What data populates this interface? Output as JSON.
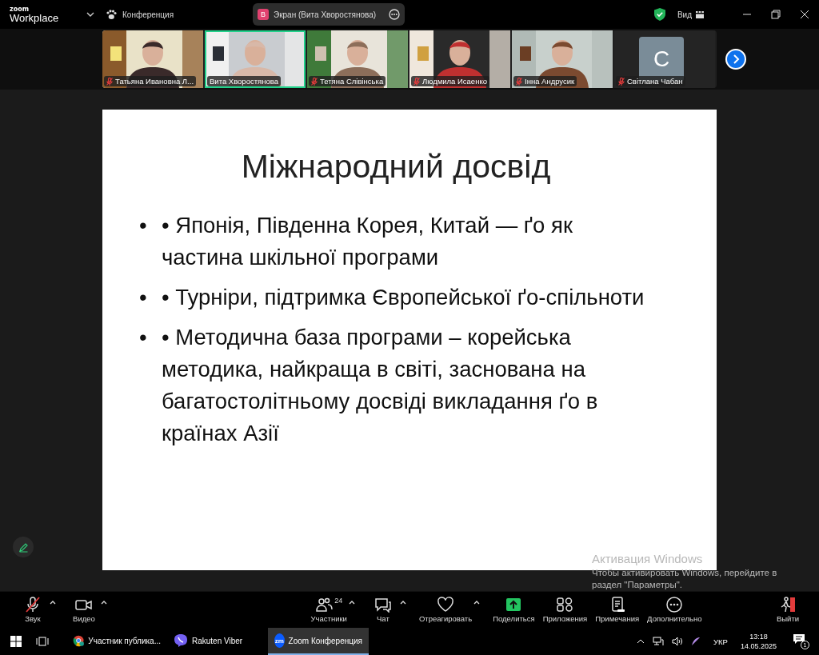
{
  "title_bar": {
    "logo_top": "zoom",
    "logo_bottom": "Workplace",
    "meeting_label": "Конференция",
    "share_badge": "В",
    "share_label": "Экран (Вита Хворостянова)",
    "view_label": "Вид"
  },
  "participants": [
    {
      "kind": "video",
      "name": "Татьяна Ивановна Л...",
      "muted": true,
      "speaking": false
    },
    {
      "kind": "video",
      "name": "Вита Хворостянова",
      "muted": false,
      "speaking": true
    },
    {
      "kind": "video",
      "name": "Тетяна Слівінська",
      "muted": true,
      "speaking": false
    },
    {
      "kind": "video",
      "name": "Людмила Исаенко",
      "muted": true,
      "speaking": false
    },
    {
      "kind": "video",
      "name": "Інна Андрусик",
      "muted": true,
      "speaking": false
    },
    {
      "kind": "avatar",
      "initial": "C",
      "name": "Світлана Чабан",
      "muted": true,
      "speaking": false
    }
  ],
  "slide": {
    "title": "Міжнародний досвід",
    "bullets": [
      {
        "marker": "•",
        "text": "• Японія, Південна Корея, Китай — ґо як частина шкільної програми"
      },
      {
        "marker": "•",
        "text": "• Турніри, підтримка Європейської ґо-спільноти"
      },
      {
        "marker": "•",
        "text": "• Методична база програми – корейська методика, найкраща в світі, заснована на багатостолітньому досвіді викладання ґо в країнах Азії"
      }
    ]
  },
  "windows_activation": {
    "title": "Активация Windows",
    "text": "Чтобы активировать Windows, перейдите в раздел \"Параметры\"."
  },
  "toolbar": {
    "left": [
      {
        "kind": "mic",
        "label": "Звук",
        "caret": true,
        "off": true
      },
      {
        "kind": "camera",
        "label": "Видео",
        "caret": true,
        "off": false
      }
    ],
    "center": [
      {
        "kind": "people",
        "label": "Участники",
        "caret": true,
        "count": "24"
      },
      {
        "kind": "chat",
        "label": "Чат",
        "caret": true
      },
      {
        "kind": "heart",
        "label": "Отреагировать",
        "caret": true
      },
      {
        "kind": "share",
        "label": "Поделиться",
        "caret": false
      },
      {
        "kind": "apps",
        "label": "Приложения",
        "caret": false
      },
      {
        "kind": "notes",
        "label": "Примечания",
        "caret": false
      },
      {
        "kind": "more",
        "label": "Дополнительно",
        "caret": false
      }
    ],
    "right": [
      {
        "kind": "leave",
        "label": "Выйти",
        "caret": false
      }
    ]
  },
  "taskbar": {
    "apps": [
      {
        "kind": "chrome",
        "label": "Участник публика...",
        "selected": false
      },
      {
        "kind": "viber",
        "label": "Rakuten Viber",
        "selected": false
      },
      {
        "kind": "zoom",
        "icon_text": "zm",
        "label": "Zoom Конференция",
        "selected": true
      }
    ],
    "language": "УКР",
    "time": "13:18",
    "date": "14.05.2025",
    "notifications": "1"
  }
}
